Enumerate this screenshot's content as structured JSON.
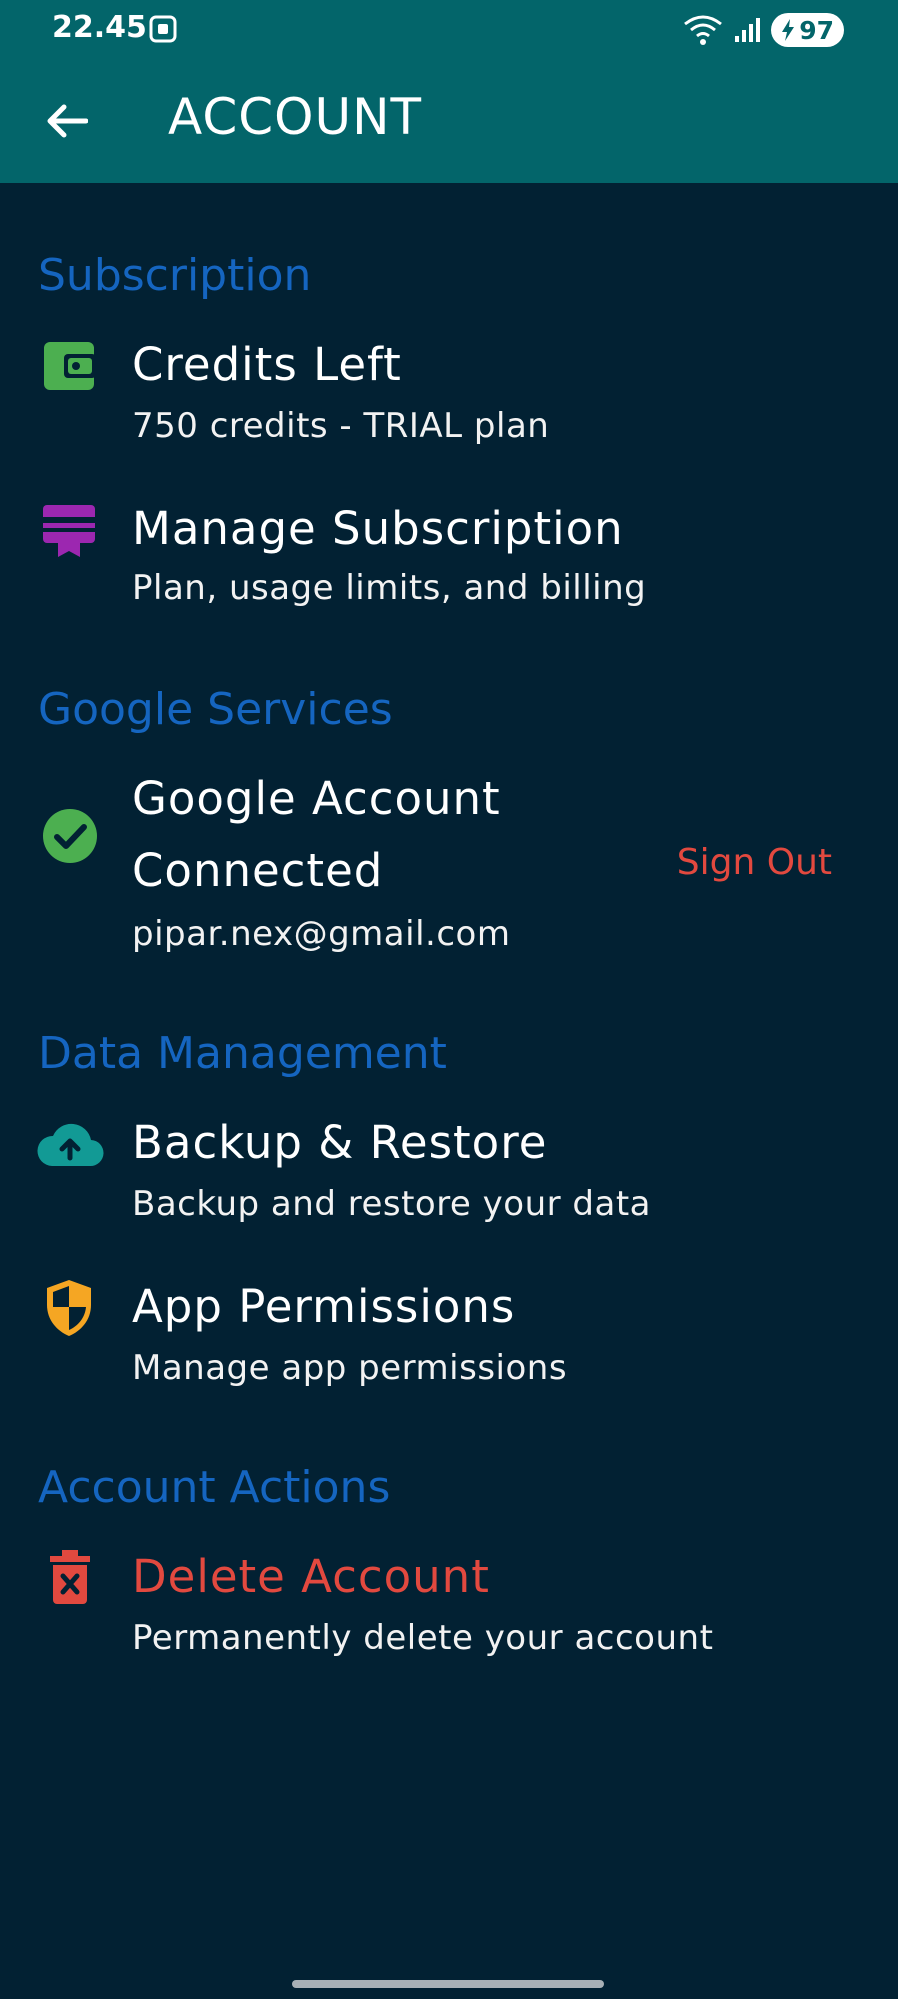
{
  "status_bar": {
    "time": "22.45",
    "battery": "97",
    "icons": [
      "screen-record-icon",
      "wifi-icon",
      "signal-icon",
      "battery-charging-icon"
    ]
  },
  "appbar": {
    "title": "ACCOUNT",
    "back_icon": "arrow-left-icon"
  },
  "sections": {
    "subscription": {
      "header": "Subscription",
      "credits": {
        "title": "Credits Left",
        "subtitle": "750 credits - TRIAL plan",
        "icon": "wallet-icon"
      },
      "manage": {
        "title": "Manage Subscription",
        "subtitle": "Plan, usage limits, and billing",
        "icon": "card-membership-icon"
      }
    },
    "google": {
      "header": "Google Services",
      "account": {
        "title_line1": "Google Account",
        "title_line2": "Connected",
        "email": "pipar.nex@gmail.com",
        "action": "Sign Out",
        "icon": "check-circle-icon"
      }
    },
    "data": {
      "header": "Data Management",
      "backup": {
        "title": "Backup & Restore",
        "subtitle": "Backup and restore your data",
        "icon": "cloud-upload-icon"
      },
      "permissions": {
        "title": "App Permissions",
        "subtitle": "Manage app permissions",
        "icon": "shield-icon"
      }
    },
    "actions": {
      "header": "Account Actions",
      "delete": {
        "title": "Delete Account",
        "subtitle": "Permanently delete your account",
        "icon": "trash-icon"
      }
    }
  },
  "colors": {
    "appbar": "#03656a",
    "background": "#022133",
    "section_header": "#1565c0",
    "danger": "#e2493f",
    "green": "#4caf50",
    "purple": "#9c27b0",
    "teal": "#129a95",
    "orange": "#f5a623"
  }
}
